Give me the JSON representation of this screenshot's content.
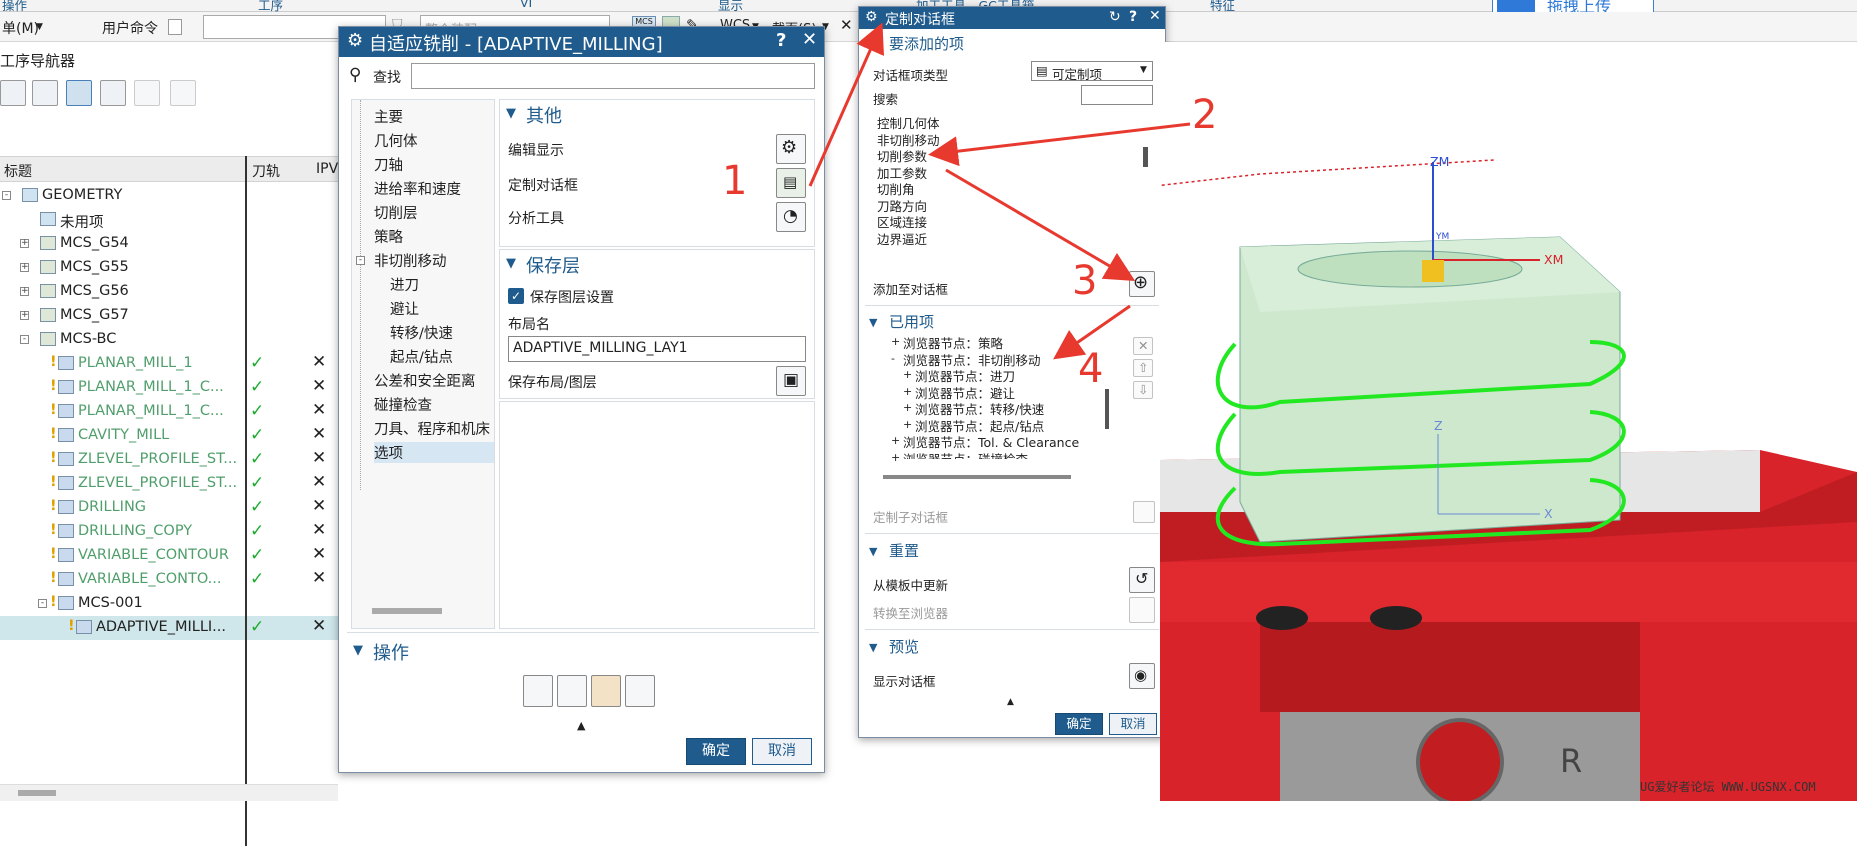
{
  "toolbar": {
    "menu_label": "单(M)",
    "user_command": "用户命令",
    "filter_placeholder": "整个装配",
    "wcs_label": "WCS",
    "section_label": "截面(S)",
    "mcs_label": "MCS",
    "top_labels": [
      "操作",
      "工序",
      "VI",
      "显示",
      "加工工具 - GC工具箱",
      "特征"
    ],
    "upload_label": "拖拽上传"
  },
  "navigator": {
    "title": "工序导航器",
    "columns": [
      "标题",
      "刀轨",
      "IPV"
    ],
    "rows": [
      {
        "indent": 0,
        "exp": "-",
        "label": "GEOMETRY",
        "style": "normal",
        "check": false,
        "x": false
      },
      {
        "indent": 1,
        "exp": "",
        "label": "未用项",
        "style": "normal",
        "check": false,
        "x": false
      },
      {
        "indent": 1,
        "exp": "+",
        "label": "MCS_G54",
        "style": "normal",
        "check": false,
        "x": false
      },
      {
        "indent": 1,
        "exp": "+",
        "label": "MCS_G55",
        "style": "normal",
        "check": false,
        "x": false
      },
      {
        "indent": 1,
        "exp": "+",
        "label": "MCS_G56",
        "style": "normal",
        "check": false,
        "x": false
      },
      {
        "indent": 1,
        "exp": "+",
        "label": "MCS_G57",
        "style": "normal",
        "check": false,
        "x": false
      },
      {
        "indent": 1,
        "exp": "-",
        "label": "MCS-BC",
        "style": "normal",
        "check": false,
        "x": false
      },
      {
        "indent": 2,
        "exp": "",
        "label": "PLANAR_MILL_1",
        "style": "green",
        "check": true,
        "x": true
      },
      {
        "indent": 2,
        "exp": "",
        "label": "PLANAR_MILL_1_C...",
        "style": "green",
        "check": true,
        "x": true
      },
      {
        "indent": 2,
        "exp": "",
        "label": "PLANAR_MILL_1_C...",
        "style": "green",
        "check": true,
        "x": true
      },
      {
        "indent": 2,
        "exp": "",
        "label": "CAVITY_MILL",
        "style": "green",
        "check": true,
        "x": true
      },
      {
        "indent": 2,
        "exp": "",
        "label": "ZLEVEL_PROFILE_ST...",
        "style": "green",
        "check": true,
        "x": true
      },
      {
        "indent": 2,
        "exp": "",
        "label": "ZLEVEL_PROFILE_ST...",
        "style": "green",
        "check": true,
        "x": true
      },
      {
        "indent": 2,
        "exp": "",
        "label": "DRILLING",
        "style": "green",
        "check": true,
        "x": true
      },
      {
        "indent": 2,
        "exp": "",
        "label": "DRILLING_COPY",
        "style": "green",
        "check": true,
        "x": true
      },
      {
        "indent": 2,
        "exp": "",
        "label": "VARIABLE_CONTOUR",
        "style": "green",
        "check": true,
        "x": true
      },
      {
        "indent": 2,
        "exp": "",
        "label": "VARIABLE_CONTO...",
        "style": "green",
        "check": true,
        "x": true
      },
      {
        "indent": 2,
        "exp": "-",
        "label": "MCS-001",
        "style": "normal",
        "check": false,
        "x": false
      },
      {
        "indent": 3,
        "exp": "",
        "label": "ADAPTIVE_MILLI...",
        "style": "selected",
        "check": true,
        "x": true
      }
    ]
  },
  "dialog_main": {
    "title": "自适应铣削 - [ADAPTIVE_MILLING]",
    "search_label": "查找",
    "tree": [
      "主要",
      "几何体",
      "刀轴",
      "进给率和速度",
      "切削层",
      "策略",
      "非切削移动",
      "进刀",
      "避让",
      "转移/快速",
      "起点/钻点",
      "公差和安全距离",
      "碰撞检查",
      "刀具、程序和机床",
      "选项"
    ],
    "section_other": "其他",
    "edit_display": "编辑显示",
    "custom_dialog": "定制对话框",
    "analysis_tools": "分析工具",
    "section_save": "保存层",
    "save_layer_checkbox": "保存图层设置",
    "layout_name_label": "布局名",
    "layout_name_value": "ADAPTIVE_MILLING_LAY1",
    "save_layout": "保存布局/图层",
    "section_ops": "操作",
    "ok": "确定",
    "cancel": "取消"
  },
  "dialog_custom": {
    "title": "定制对话框",
    "section_add": "要添加的项",
    "item_type_label": "对话框项类型",
    "item_type_value": "可定制项",
    "search_label": "搜索",
    "items": [
      "控制几何体",
      "非切削移动",
      "切削参数",
      "加工参数",
      "切削角",
      "刀路方向",
      "区域连接",
      "边界逼近"
    ],
    "add_to_dialog": "添加至对话框",
    "section_used": "已用项",
    "used_items": [
      {
        "indent": 1,
        "exp": "+",
        "label": "浏览器节点：策略"
      },
      {
        "indent": 1,
        "exp": "-",
        "label": "浏览器节点：非切削移动"
      },
      {
        "indent": 2,
        "exp": "+",
        "label": "浏览器节点：进刀"
      },
      {
        "indent": 2,
        "exp": "+",
        "label": "浏览器节点：避让"
      },
      {
        "indent": 2,
        "exp": "+",
        "label": "浏览器节点：转移/快速"
      },
      {
        "indent": 2,
        "exp": "+",
        "label": "浏览器节点：起点/钻点"
      },
      {
        "indent": 1,
        "exp": "+",
        "label": "浏览器节点：Tol. & Clearance"
      },
      {
        "indent": 1,
        "exp": "+",
        "label": "浏览器节点：碰撞检查"
      }
    ],
    "custom_subdialog": "定制子对话框",
    "section_reset": "重置",
    "update_from_template": "从模板中更新",
    "convert_to_browser": "转换至浏览器",
    "section_preview": "预览",
    "show_dialog": "显示对话框",
    "ok": "确定",
    "cancel": "取消"
  },
  "annotations": {
    "n1": "1",
    "n2": "2",
    "n3": "3",
    "n4": "4"
  },
  "viewport": {
    "axis_zm": "ZM",
    "axis_xm": "XM",
    "axis_ym": "YM",
    "axis_z": "Z",
    "axis_x": "X",
    "letter_r": "R"
  },
  "watermark": "UG爱好者论坛 WWW.UGSNX.COM",
  "colors": {
    "dialog_title": "#1f5b8c",
    "arrow": "#e8392f",
    "check": "#1dab2e",
    "part_red": "#d8232a",
    "toolpath": "#22e822"
  }
}
